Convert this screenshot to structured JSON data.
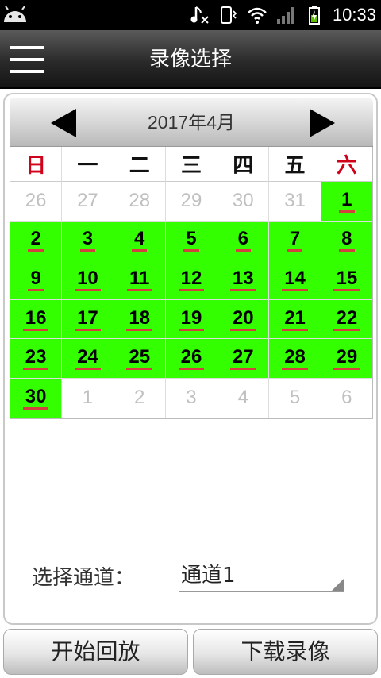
{
  "status_bar": {
    "time": "10:33",
    "icons": [
      "android-icon",
      "music-muted-icon",
      "vibrate-icon",
      "wifi-icon",
      "signal-icon",
      "battery-charging-icon"
    ]
  },
  "header": {
    "title": "录像选择",
    "menu_icon": "hamburger-menu-icon"
  },
  "calendar": {
    "month_label": "2017年4月",
    "weekdays": [
      "日",
      "一",
      "二",
      "三",
      "四",
      "五",
      "六"
    ],
    "weeks": [
      [
        {
          "d": "26",
          "s": "other"
        },
        {
          "d": "27",
          "s": "other"
        },
        {
          "d": "28",
          "s": "other"
        },
        {
          "d": "29",
          "s": "other"
        },
        {
          "d": "30",
          "s": "other"
        },
        {
          "d": "31",
          "s": "other"
        },
        {
          "d": "1",
          "s": "rec"
        }
      ],
      [
        {
          "d": "2",
          "s": "rec"
        },
        {
          "d": "3",
          "s": "rec"
        },
        {
          "d": "4",
          "s": "rec"
        },
        {
          "d": "5",
          "s": "rec"
        },
        {
          "d": "6",
          "s": "rec"
        },
        {
          "d": "7",
          "s": "rec"
        },
        {
          "d": "8",
          "s": "rec"
        }
      ],
      [
        {
          "d": "9",
          "s": "rec"
        },
        {
          "d": "10",
          "s": "rec"
        },
        {
          "d": "11",
          "s": "rec"
        },
        {
          "d": "12",
          "s": "rec"
        },
        {
          "d": "13",
          "s": "rec"
        },
        {
          "d": "14",
          "s": "rec"
        },
        {
          "d": "15",
          "s": "rec"
        }
      ],
      [
        {
          "d": "16",
          "s": "rec"
        },
        {
          "d": "17",
          "s": "rec"
        },
        {
          "d": "18",
          "s": "rec"
        },
        {
          "d": "19",
          "s": "rec"
        },
        {
          "d": "20",
          "s": "rec"
        },
        {
          "d": "21",
          "s": "rec"
        },
        {
          "d": "22",
          "s": "rec"
        }
      ],
      [
        {
          "d": "23",
          "s": "rec"
        },
        {
          "d": "24",
          "s": "rec"
        },
        {
          "d": "25",
          "s": "rec"
        },
        {
          "d": "26",
          "s": "rec"
        },
        {
          "d": "27",
          "s": "rec"
        },
        {
          "d": "28",
          "s": "rec"
        },
        {
          "d": "29",
          "s": "rec"
        }
      ],
      [
        {
          "d": "30",
          "s": "rec"
        },
        {
          "d": "1",
          "s": "other"
        },
        {
          "d": "2",
          "s": "other"
        },
        {
          "d": "3",
          "s": "other"
        },
        {
          "d": "4",
          "s": "other"
        },
        {
          "d": "5",
          "s": "other"
        },
        {
          "d": "6",
          "s": "other"
        }
      ]
    ],
    "colors": {
      "recorded": "#33ff00",
      "weekend_header": "#d0021b",
      "underline": "#d24040",
      "muted": "#c0c0c0"
    }
  },
  "channel": {
    "label": "选择通道：",
    "value": "通道1"
  },
  "buttons": {
    "play": "开始回放",
    "download": "下载录像"
  }
}
